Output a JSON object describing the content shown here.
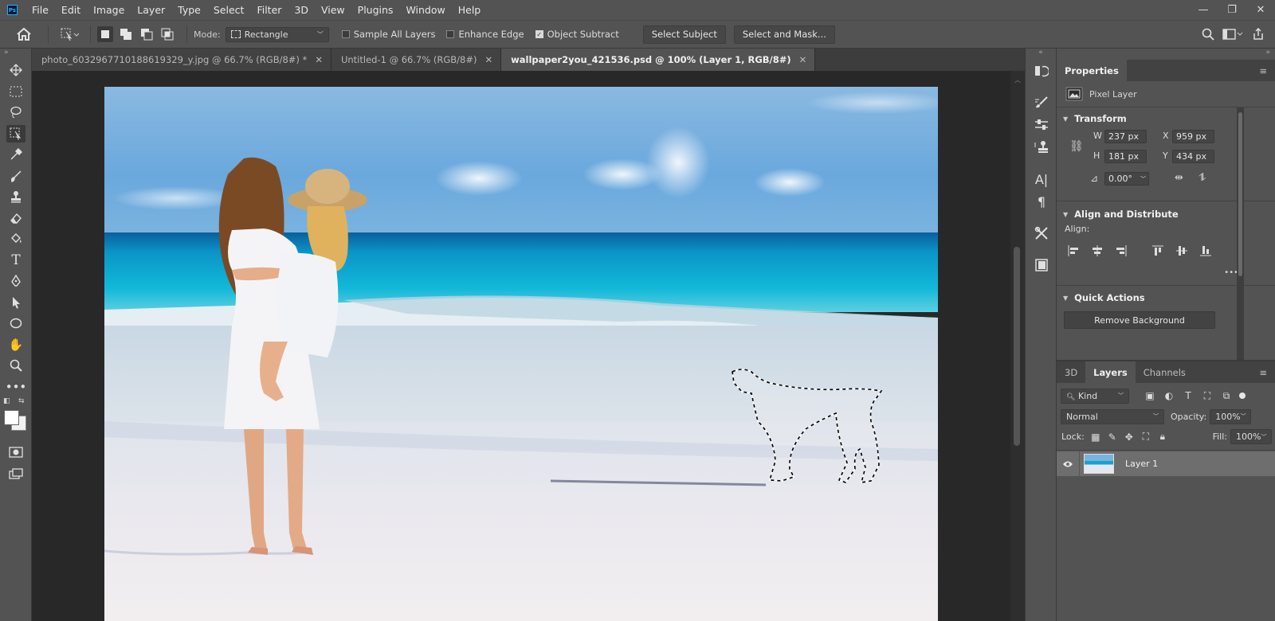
{
  "menubar": {
    "logo": "Ps",
    "items": [
      "File",
      "Edit",
      "Image",
      "Layer",
      "Type",
      "Select",
      "Filter",
      "3D",
      "View",
      "Plugins",
      "Window",
      "Help"
    ]
  },
  "window_controls": {
    "minimize": "—",
    "restore": "❐",
    "close": "✕"
  },
  "options": {
    "mode_label": "Mode:",
    "mode_value": "Rectangle",
    "sample_all_layers": {
      "label": "Sample All Layers",
      "checked": false
    },
    "enhance_edge": {
      "label": "Enhance Edge",
      "checked": false
    },
    "object_subtract": {
      "label": "Object Subtract",
      "checked": true
    },
    "select_subject": "Select Subject",
    "select_and_mask": "Select and Mask..."
  },
  "tabs": [
    {
      "label": "photo_6032967710188619329_y.jpg @ 66.7% (RGB/8#) *",
      "close": "✕"
    },
    {
      "label": "Untitled-1 @ 66.7% (RGB/8#)",
      "close": "✕"
    },
    {
      "label": "wallpaper2you_421536.psd @ 100% (Layer 1, RGB/8#)",
      "close": "✕"
    }
  ],
  "properties": {
    "tab": "Properties",
    "layer_type": "Pixel Layer",
    "transform": {
      "title": "Transform",
      "w_label": "W",
      "w": "237 px",
      "x_label": "X",
      "x": "959 px",
      "h_label": "H",
      "h": "181 px",
      "y_label": "Y",
      "y": "434 px",
      "angle": "0.00°"
    },
    "align": {
      "title": "Align and Distribute",
      "label": "Align:",
      "more": "•••"
    },
    "quick_actions": {
      "title": "Quick Actions",
      "remove_bg": "Remove Background"
    }
  },
  "layers_panel": {
    "tabs": [
      "3D",
      "Layers",
      "Channels"
    ],
    "kind": "Kind",
    "blend_mode": "Normal",
    "opacity_label": "Opacity:",
    "opacity": "100%",
    "lock_label": "Lock:",
    "fill_label": "Fill:",
    "fill": "100%",
    "layers": [
      {
        "name": "Layer 1",
        "visible": true
      }
    ]
  },
  "colors": {
    "accent": "#31a8ff",
    "ui_bg": "#535353",
    "canvas_bg": "#282828"
  }
}
